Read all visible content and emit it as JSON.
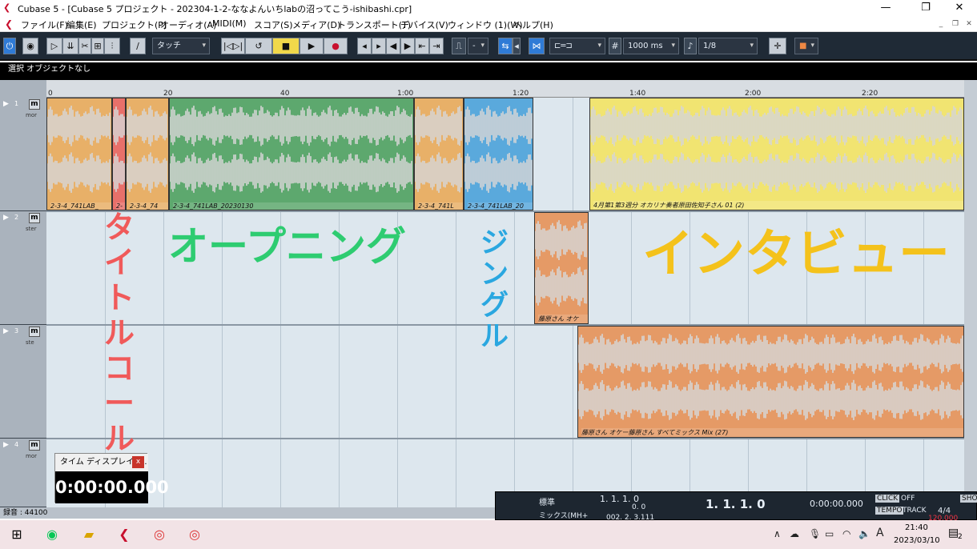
{
  "window": {
    "title": "Cubase 5 - [Cubase 5 プロジェクト - 202304-1-2-ななよんいちlabの沼ってこう-ishibashi.cpr]",
    "minimize": "—",
    "restore": "❐",
    "close": "✕"
  },
  "menu": {
    "items": [
      "ファイル(F)",
      "編集(E)",
      "プロジェクト(P)",
      "オーディオ(A)",
      "MIDI(M)",
      "スコア(S)",
      "メディア(D)",
      "トランスポート(T)",
      "デバイス(V)",
      "ウィンドウ (1)(W)",
      "ヘルプ(H)"
    ],
    "mdi_min": "_",
    "mdi_restore": "❐",
    "mdi_close": "✕"
  },
  "toolbar": {
    "automation_mode": "タッチ",
    "grid_size": "1000 ms",
    "quantize": "1/8"
  },
  "info_line": "選択 オブジェクトなし",
  "ruler": {
    "ticks": [
      "0",
      "20",
      "40",
      "1:00",
      "1:20",
      "1:40",
      "2:00",
      "2:20"
    ]
  },
  "tracks": [
    {
      "num": "1",
      "mute": "m",
      "sub": "mor"
    },
    {
      "num": "2",
      "mute": "m",
      "sub": "ster"
    },
    {
      "num": "3",
      "mute": "m",
      "sub": "ste"
    },
    {
      "num": "4",
      "mute": "m",
      "sub": "mor"
    }
  ],
  "clips": {
    "t1a": "2-3-4_741LAB_",
    "t1b": "2-",
    "t1c": "2-3-4_74",
    "t1d": "2-3-4_741LAB_20230130",
    "t1e": "2-3-4_741L",
    "t1f": "2-3-4_741LAB_20",
    "t1g": "4月第1第3週分 オカリナ奏者原田佐知子さん 01 (2)",
    "t2a": "藤原さん オケ",
    "t3a": "藤原さん オケー藤原さん すべてミックス Mix (27)"
  },
  "overlays": {
    "title_call": "タイトルコール",
    "opening": "オープニング",
    "jingle": "ジングル",
    "interview": "インタビュー"
  },
  "colors": {
    "title_call": "#f05a5a",
    "opening": "#2ecc71",
    "jingle": "#2aa7e0",
    "interview": "#f4c21b",
    "clip_orange": "#e8b068",
    "clip_red": "#e8706a",
    "clip_green": "#5da86e",
    "clip_blue": "#5aa9dc",
    "clip_yellow": "#f1e471",
    "clip_salmon": "#e59a66"
  },
  "time_display": {
    "title": "タイム ディスプレイ -...",
    "close": "x",
    "value": "0:00:00.000"
  },
  "status": {
    "rec": "録音 : 44100"
  },
  "transport": {
    "mode_label": "標準",
    "mix_label": "ミックス(MH+",
    "pos1": "1. 1. 1.   0",
    "pos1_sub": "0.  0",
    "pos1_sub2": "002.  2. 3.111",
    "main_pos": "1. 1. 1.   0",
    "time": "0:00:00.000",
    "click_label": "CLICK",
    "click_val": "OFF",
    "tempo_label": "TEMPO",
    "track_label": "TRACK",
    "sig": "4/4",
    "tempo_val": "120.000",
    "show_label": "SHOW"
  },
  "taskbar": {
    "time": "21:40",
    "date": "2023/03/10",
    "ime": "A",
    "notif_count": "2"
  }
}
